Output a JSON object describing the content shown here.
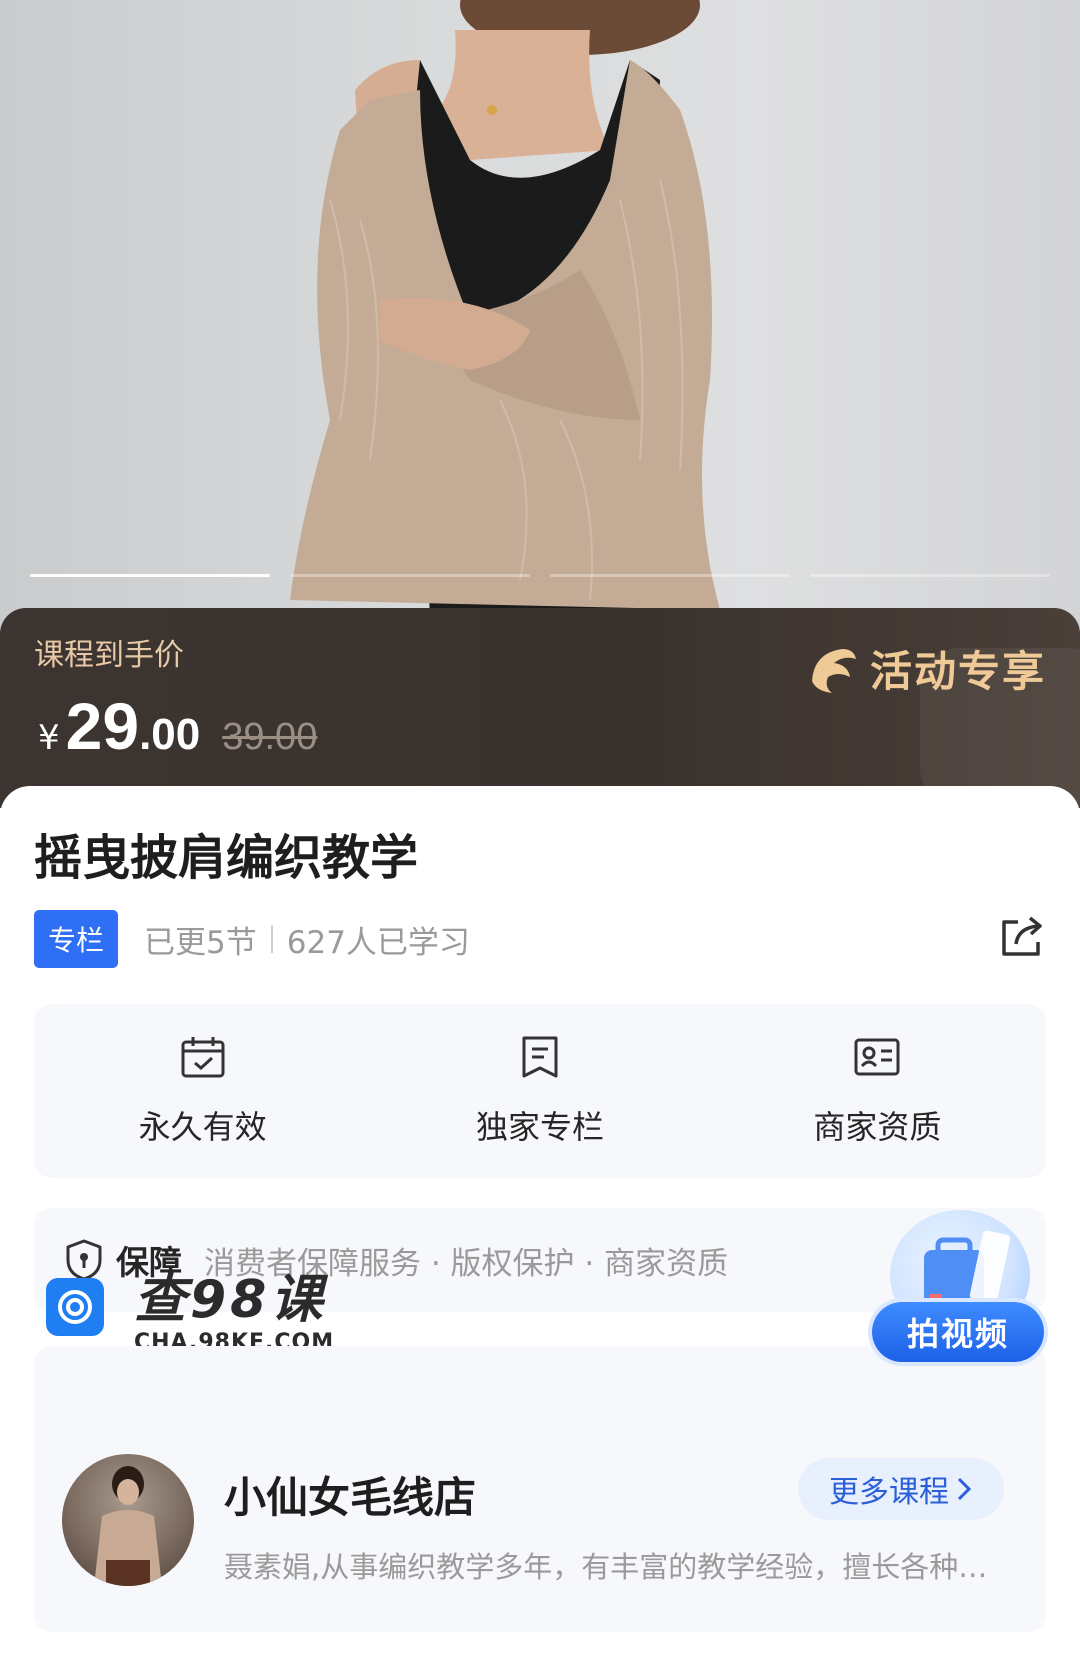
{
  "hero": {
    "carousel_segments": 4,
    "active_segment": 1
  },
  "price": {
    "label": "课程到手价",
    "currency": "¥",
    "integer": "29",
    "decimal": ".00",
    "original": "39.00",
    "promo": "活动专享"
  },
  "course": {
    "title": "摇曳披肩编织教学",
    "tag": "专栏",
    "updated": "已更5节",
    "learners": "627人已学习"
  },
  "features": [
    {
      "label": "永久有效",
      "icon": "calendar-check-icon"
    },
    {
      "label": "独家专栏",
      "icon": "bookmark-doc-icon"
    },
    {
      "label": "商家资质",
      "icon": "id-card-icon"
    }
  ],
  "guarantee": {
    "title": "保障",
    "items": "消费者保障服务 · 版权保护 · 商家资质"
  },
  "watermark": {
    "cn": "查98课",
    "url": "CHA.98KE.COM"
  },
  "float_button": {
    "label": "拍视频"
  },
  "shop": {
    "name": "小仙女毛线店",
    "more": "更多课程",
    "description": "聂素娟,从事编织教学多年，有丰富的教学经验，擅长各种编织技法的教学"
  },
  "colors": {
    "accent": "#2f6ff5",
    "price_band": "#3c3430",
    "promo_gold": "#efc996"
  }
}
